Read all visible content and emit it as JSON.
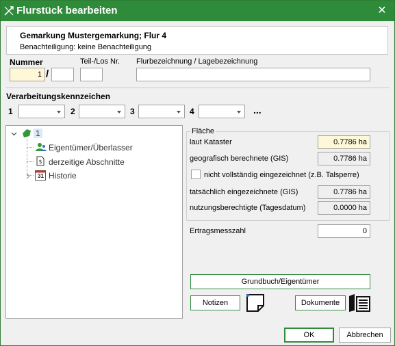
{
  "window": {
    "title": "Flurstück bearbeiten",
    "close_glyph": "✕",
    "accent": "#2e8b3a"
  },
  "header": {
    "gemarkung": "Gemarkung Mustergemarkung; Flur 4",
    "benachteiligung_label": "Benachteiligung:",
    "benachteiligung_value": "keine Benachteiligung"
  },
  "identification": {
    "nummer_label": "Nummer",
    "nummer_value": "1",
    "slash": "/",
    "nummer_sub_value": "",
    "teil_los_label": "Teil-/Los Nr.",
    "teil_los_value": "",
    "flurbezeichnung_label": "Flurbezeichnung / Lagebezeichnung",
    "flurbezeichnung_value": ""
  },
  "verarbeitung": {
    "label": "Verarbeitungskennzeichen",
    "slots": [
      {
        "number": "1",
        "value": ""
      },
      {
        "number": "2",
        "value": ""
      },
      {
        "number": "3",
        "value": ""
      },
      {
        "number": "4",
        "value": ""
      }
    ],
    "more_label": "..."
  },
  "tree": {
    "root_label": "1",
    "items": [
      {
        "label": "Eigentümer/Überlasser",
        "icon": "users-icon"
      },
      {
        "label": "derzeitige Abschnitte",
        "icon": "document-icon"
      },
      {
        "label": "Historie",
        "icon": "calendar-icon",
        "calendar_day": "31"
      }
    ]
  },
  "flaeche": {
    "group_label": "Fläche",
    "laut_kataster_label": "laut Kataster",
    "laut_kataster_value": "0.7786 ha",
    "geografisch_label": "geografisch berechnete (GIS)",
    "geografisch_value": "0.7786 ha",
    "nicht_vollstaendig_label": "nicht vollständig eingezeichnet (z.B. Talsperre)",
    "nicht_vollstaendig_checked": false,
    "tatsaechlich_label": "tatsächlich eingezeichnete (GIS)",
    "tatsaechlich_value": "0.7786 ha",
    "nutzungsberechtigte_label": "nutzungsberechtigte (Tagesdatum)",
    "nutzungsberechtigte_value": "0.0000 ha"
  },
  "ertrag": {
    "label": "Ertragsmesszahl",
    "value": "0"
  },
  "buttons": {
    "grundbuch": "Grundbuch/Eigentümer",
    "notizen": "Notizen",
    "dokumente": "Dokumente",
    "ok": "OK",
    "abbrechen": "Abbrechen"
  }
}
